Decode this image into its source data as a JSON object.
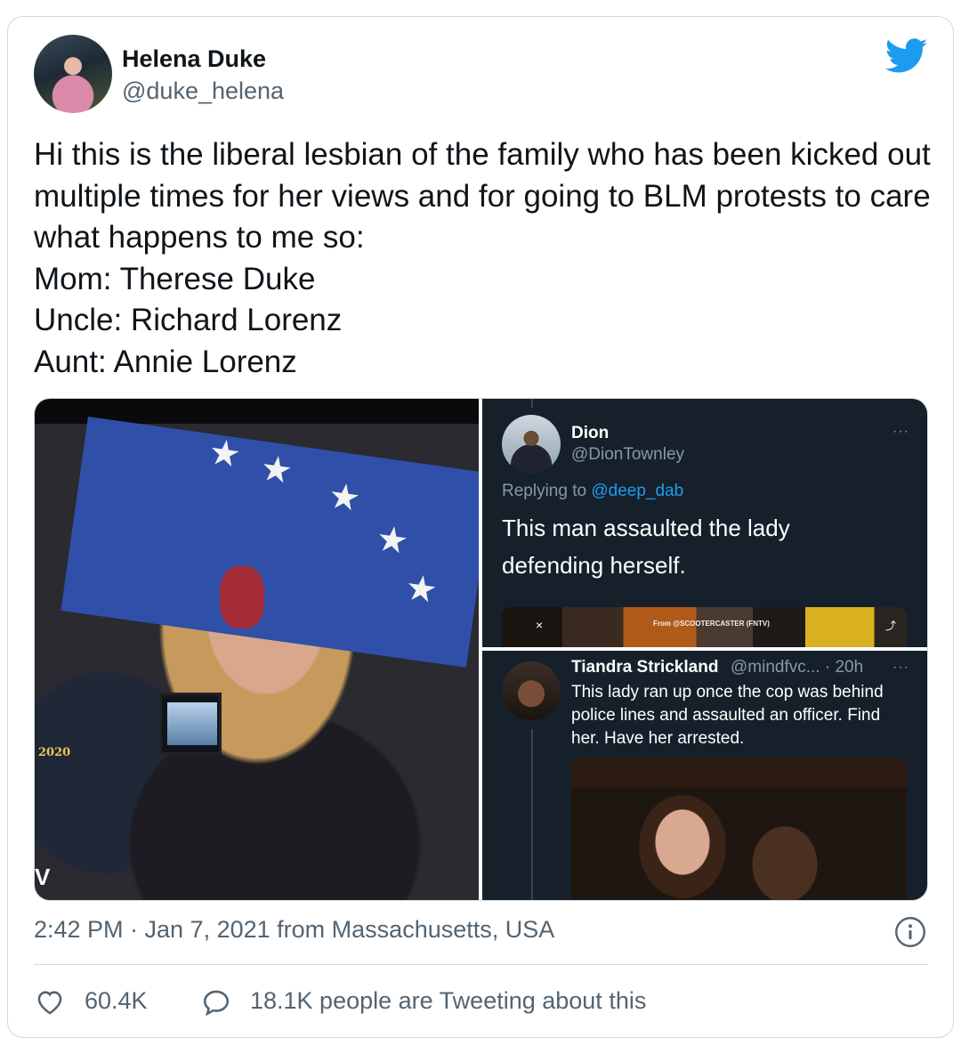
{
  "author": {
    "name": "Helena Duke",
    "handle": "@duke_helena"
  },
  "tweet_text": "Hi this is the liberal lesbian of the family who has been kicked out multiple times for her views and for going to BLM protests to care what happens to me so:\nMom: Therese Duke\nUncle: Richard Lorenz\nAunt: Annie Lorenz",
  "photo_left": {
    "corner_text": "2020",
    "edge_letter": "V"
  },
  "embedded_top": {
    "name": "Dion",
    "handle": "@DionTownley",
    "replying_prefix": "Replying to ",
    "replying_to": "@deep_dab",
    "text": "This man assaulted the lady defending herself.",
    "more": "···",
    "video_close": "×",
    "video_source": "From @SCOOTERCASTER (FNTV)"
  },
  "embedded_bottom": {
    "name": "Tiandra Strickland",
    "meta": "@mindfvc... · 20h",
    "more": "···",
    "text": "This lady ran up once the cop was behind police lines and assaulted an officer. Find her. Have her arrested."
  },
  "timestamp": "2:42 PM · Jan 7, 2021 from Massachusetts, USA",
  "stats": {
    "likes": "60.4K",
    "talking": "18.1K people are Tweeting about this"
  },
  "colors": {
    "twitter_blue": "#1d9bf0",
    "dark_bg": "#15202b",
    "muted": "#536471"
  }
}
